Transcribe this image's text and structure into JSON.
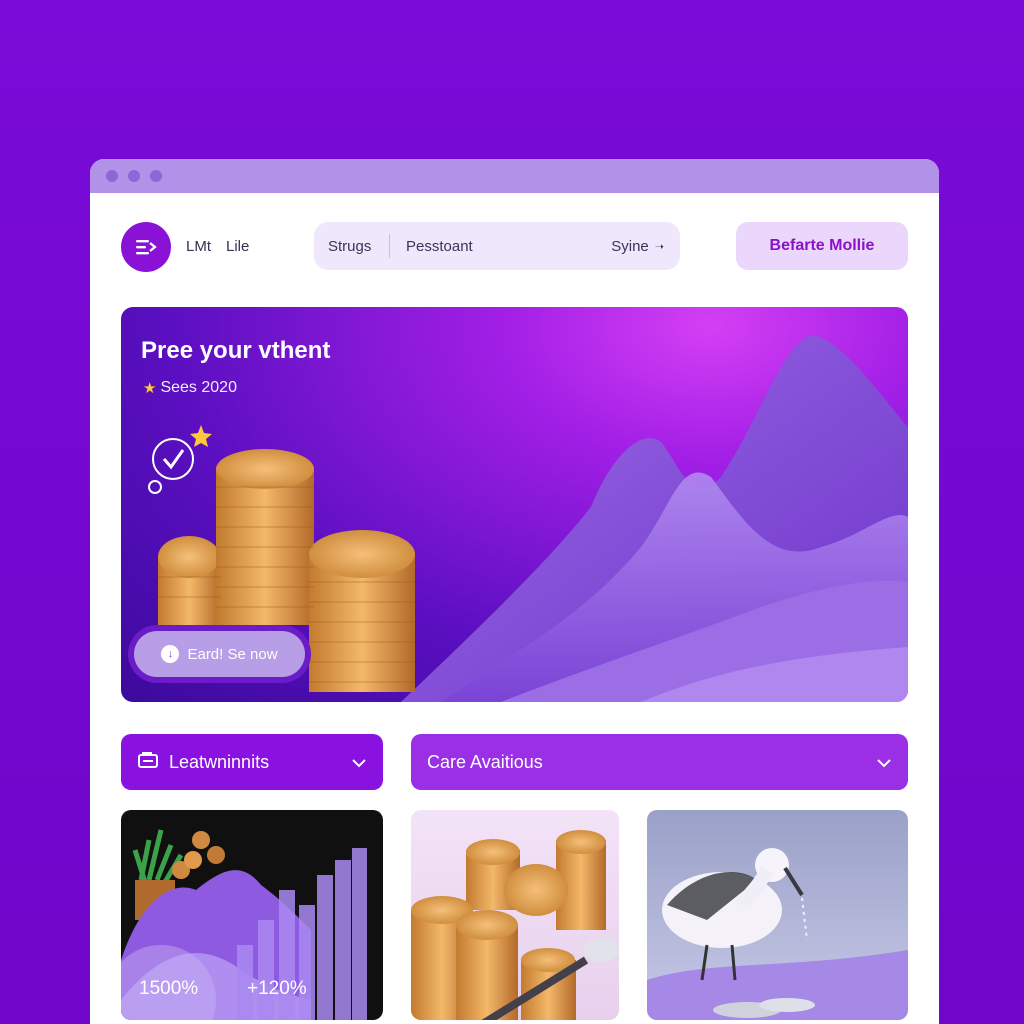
{
  "header": {
    "nav": [
      "LMt",
      "Lile"
    ],
    "search": {
      "tab": "Strugs",
      "placeholder": "Pesstoant",
      "action": "Syine"
    },
    "cta": "Befarte Mollie"
  },
  "hero": {
    "title": "Pree your vthent",
    "subtitle": "Sees 2020",
    "button": "Eard! Se now"
  },
  "dropdowns": [
    {
      "label": "Leatwninnits"
    },
    {
      "label": "Care Avaitious"
    }
  ],
  "cards": {
    "stats": [
      "1500%",
      "+120%"
    ]
  },
  "colors": {
    "background": "#7a0bd8",
    "accent": "#8a12e0",
    "cta_text": "#8a12c8"
  }
}
